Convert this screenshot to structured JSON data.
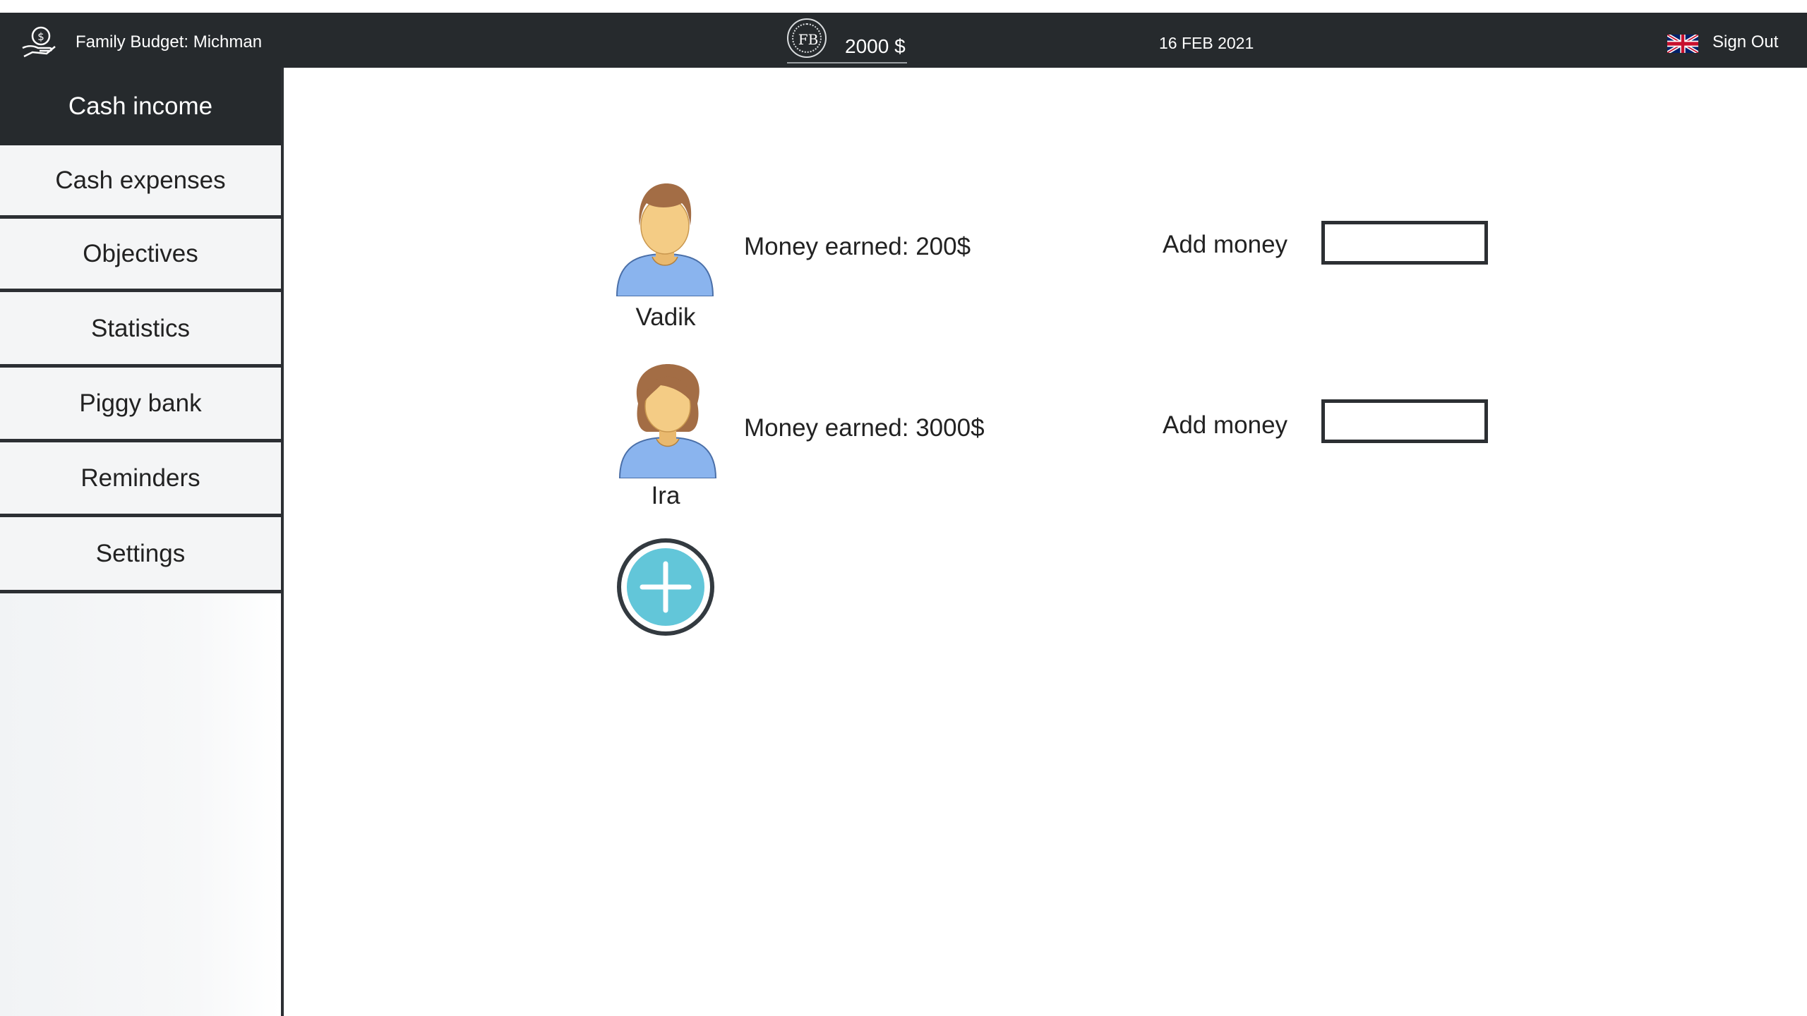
{
  "header": {
    "app_title": "Family Budget: Michman",
    "coin_label": "FB",
    "balance": "2000 $",
    "date": "16 FEB 2021",
    "language_flag": "uk-flag-icon",
    "sign_out": "Sign Out"
  },
  "sidebar": {
    "items": [
      {
        "label": "Cash income",
        "active": true
      },
      {
        "label": "Cash expenses",
        "active": false
      },
      {
        "label": "Objectives",
        "active": false
      },
      {
        "label": "Statistics",
        "active": false
      },
      {
        "label": "Piggy bank",
        "active": false
      },
      {
        "label": "Reminders",
        "active": false
      },
      {
        "label": "Settings",
        "active": false
      }
    ]
  },
  "main": {
    "people": [
      {
        "name": "Vadik",
        "earned": "Money earned: 200$",
        "add_label": "Add money",
        "input_value": ""
      },
      {
        "name": "Ira",
        "earned": "Money earned: 3000$",
        "add_label": "Add money",
        "input_value": ""
      }
    ],
    "add_person_icon": "plus-icon"
  },
  "colors": {
    "topbar": "#262a2d",
    "accent": "#62c6d9",
    "skin": "#f4cc85",
    "hair": "#a36d45",
    "shirt": "#8ab4ee"
  }
}
